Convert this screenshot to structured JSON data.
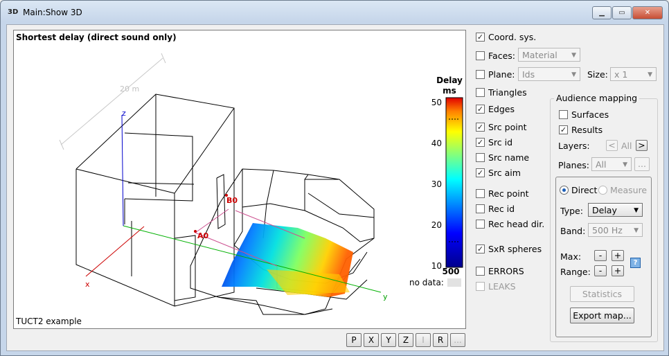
{
  "window": {
    "icon_text": "3D",
    "title": "Main:Show 3D"
  },
  "view": {
    "title": "Shortest delay (direct sound only)",
    "footer": "TUCT2 example",
    "scale_label": "20 m",
    "axis_labels": {
      "x": "x",
      "y": "y",
      "z": "z"
    },
    "source_label": "A0",
    "receiver_label": "B0"
  },
  "legend": {
    "title": "Delay",
    "unit": "ms",
    "ticks": [
      "50",
      "40",
      "30",
      "20",
      "10"
    ],
    "bottom_value": "500",
    "nodata_label": "no data:"
  },
  "view_buttons": [
    {
      "label": "P",
      "enabled": true
    },
    {
      "label": "X",
      "enabled": true
    },
    {
      "label": "Y",
      "enabled": true
    },
    {
      "label": "Z",
      "enabled": true
    },
    {
      "label": "I",
      "enabled": false
    },
    {
      "label": "R",
      "enabled": true
    },
    {
      "label": "...",
      "enabled": false
    }
  ],
  "options": {
    "coord_sys": {
      "label": "Coord. sys.",
      "checked": true
    },
    "faces": {
      "label": "Faces:",
      "checked": false,
      "combo": "Material"
    },
    "plane": {
      "label": "Plane:",
      "checked": false,
      "combo": "Ids"
    },
    "size": {
      "label": "Size:",
      "combo": "x 1"
    },
    "triangles": {
      "label": "Triangles",
      "checked": false
    },
    "edges": {
      "label": "Edges",
      "checked": true
    },
    "src_point": {
      "label": "Src point",
      "checked": true
    },
    "src_id": {
      "label": "Src id",
      "checked": true
    },
    "src_name": {
      "label": "Src name",
      "checked": false
    },
    "src_aim": {
      "label": "Src aim",
      "checked": true
    },
    "rec_point": {
      "label": "Rec point",
      "checked": false
    },
    "rec_id": {
      "label": "Rec id",
      "checked": false
    },
    "rec_head_dir": {
      "label": "Rec head dir.",
      "checked": false
    },
    "sxr_spheres": {
      "label": "SxR spheres",
      "checked": true
    },
    "errors": {
      "label": "ERRORS",
      "checked": false
    },
    "leaks": {
      "label": "LEAKS",
      "checked": false
    }
  },
  "audience": {
    "title": "Audience mapping",
    "surfaces": {
      "label": "Surfaces",
      "checked": false
    },
    "results": {
      "label": "Results",
      "checked": true
    },
    "layers_label": "Layers:",
    "layers_value": "All",
    "planes_label": "Planes:",
    "planes_combo": "All",
    "planes_more": "...",
    "direct_label": "Direct",
    "measure_label": "Measure",
    "type_label": "Type:",
    "type_combo": "Delay",
    "band_label": "Band:",
    "band_combo": "500 Hz",
    "max_label": "Max:",
    "range_label": "Range:",
    "minus": "-",
    "plus": "+",
    "help": "?",
    "statistics": "Statistics",
    "export": "Export map..."
  },
  "colors": {
    "accent": "#1c5fb8",
    "source": "#cc0000",
    "axis_x": "#cc0000",
    "axis_y": "#00b000",
    "axis_z": "#0000cc"
  }
}
